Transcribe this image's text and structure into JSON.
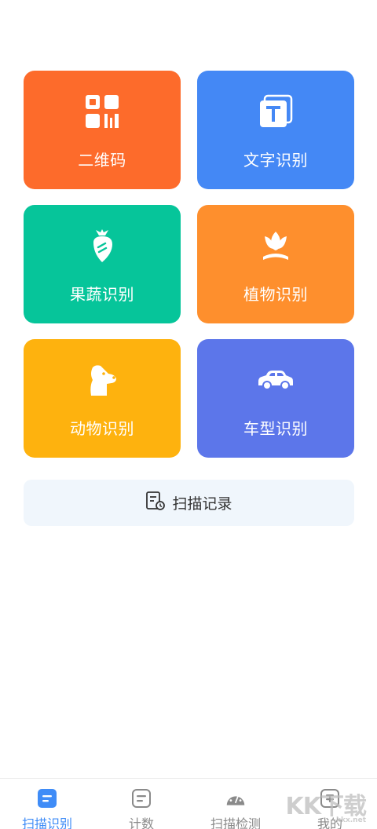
{
  "tiles": [
    {
      "label": "二维码",
      "icon": "qr-code-icon",
      "color": "#fd6b2b"
    },
    {
      "label": "文字识别",
      "icon": "text-recognition-icon",
      "color": "#4488f5"
    },
    {
      "label": "果蔬识别",
      "icon": "carrot-icon",
      "color": "#06c59a"
    },
    {
      "label": "植物识别",
      "icon": "flower-icon",
      "color": "#fe8f2d"
    },
    {
      "label": "动物识别",
      "icon": "dog-icon",
      "color": "#feb20e"
    },
    {
      "label": "车型识别",
      "icon": "car-icon",
      "color": "#5c76ea"
    }
  ],
  "record": {
    "label": "扫描记录",
    "icon": "document-clock-icon"
  },
  "tabbar": {
    "items": [
      {
        "label": "扫描识别",
        "icon": "scan-icon",
        "active": true
      },
      {
        "label": "计数",
        "icon": "note-icon",
        "active": false
      },
      {
        "label": "扫描检测",
        "icon": "gauge-icon",
        "active": false
      },
      {
        "label": "我的",
        "icon": "profile-icon",
        "active": false
      }
    ],
    "active_color": "#3f8cf7",
    "inactive_color": "#8a8a8a"
  },
  "watermark": {
    "brand": "KK下载",
    "domain": "kkx.net"
  }
}
